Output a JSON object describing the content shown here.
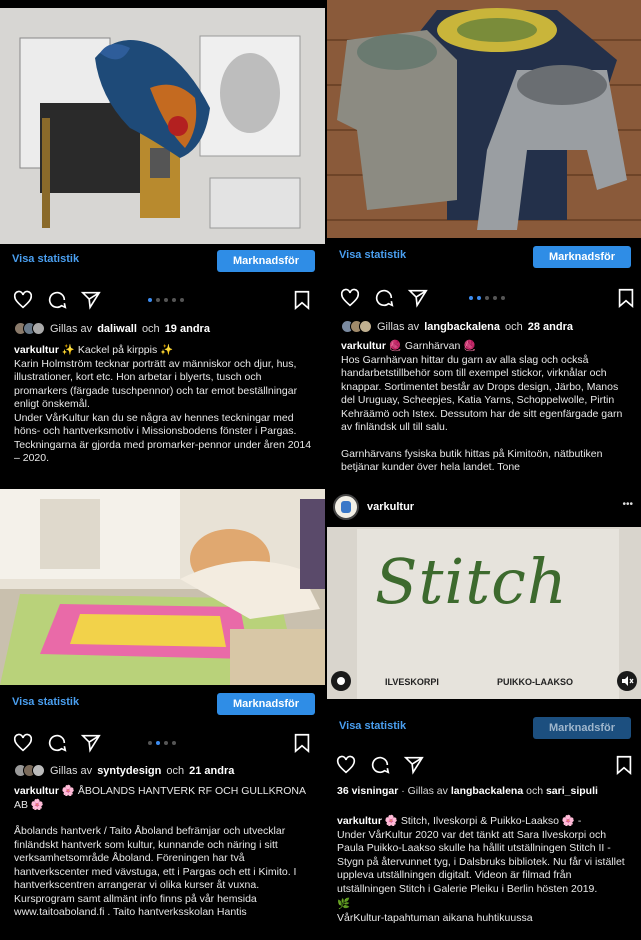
{
  "posts": [
    {
      "stats_label": "Visa statistik",
      "promote_label": "Marknadsför",
      "liked_by_prefix": "Gillas av",
      "liked_by_user": "daliwall",
      "liked_by_suffix": "och",
      "liked_by_others": "19 andra",
      "username": "varkultur",
      "caption_title": "✨ Kackel på kirppis ✨",
      "caption_body": "Karin Holmström tecknar porträtt av människor och djur, hus, illustrationer, kort etc. Hon arbetar i blyerts, tusch och promarkers (färgade tuschpennor) och tar emot beställningar enligt önskemål.",
      "caption_body2": "Under VårKultur kan du se några av hennes teckningar med höns- och hantverksmotiv i Missionsbodens fönster i Pargas. Teckningarna är gjorda med promarker-pennor under åren 2014 – 2020."
    },
    {
      "stats_label": "Visa statistik",
      "promote_label": "Marknadsför",
      "liked_by_prefix": "Gillas av",
      "liked_by_user": "langbackalena",
      "liked_by_suffix": "och",
      "liked_by_others": "28 andra",
      "username": "varkultur",
      "caption_title": "🧶 Garnhärvan 🧶",
      "caption_body": "Hos Garnhärvan hittar du garn av alla slag och också handarbetstillbehör som till exempel stickor, virknålar och knappar. Sortimentet består av Drops design, Järbo, Manos del Uruguay, Scheepjes, Katia Yarns, Schoppelwolle, Pirtin Kehräämö och Istex. Dessutom har de sitt egenfärgade garn av finländsk ull till salu.",
      "caption_body2": "Garnhärvans fysiska butik hittas på Kimitoön, nätbutiken betjänar kunder över hela landet. Tone"
    },
    {
      "stats_label": "Visa statistik",
      "promote_label": "Marknadsför",
      "liked_by_prefix": "Gillas av",
      "liked_by_user": "syntydesign",
      "liked_by_suffix": "och",
      "liked_by_others": "21 andra",
      "username": "varkultur",
      "caption_title": "🌸 ÅBOLANDS HANTVERK RF OCH GULLKRONA AB 🌸",
      "caption_body": "Åbolands hantverk / Taito Åboland befrämjar och utvecklar finländskt hantverk som kultur, kunnande och näring i sitt verksamhetsområde Åboland. Föreningen har två hantverkscenter med vävstuga, ett i Pargas och ett i Kimito. I hantverkscentren arrangerar vi olika kurser åt vuxna. Kursprogram samt allmänt info finns på vår hemsida www.taitoaboland.fi . Taito hantverksskolan Hantis"
    },
    {
      "header_username": "varkultur",
      "more_label": "•••",
      "video_title": "Stitch",
      "video_subtitle_left": "ILVESKORPI",
      "video_subtitle_right": "PUIKKO-LAAKSO",
      "stats_label": "Visa statistik",
      "promote_label": "Marknadsför",
      "views": "36 visningar",
      "liked_by_prefix": "· Gillas av",
      "liked_by_user": "langbackalena",
      "liked_by_suffix": "och",
      "liked_by_user2": "sari_sipuli",
      "username": "varkultur",
      "caption_title": "🌸 Stitch, Ilveskorpi & Puikko-Laakso 🌸 -",
      "caption_body": "Under VårKultur 2020 var det tänkt att Sara Ilveskorpi och Paula Puikko-Laakso skulle ha hållit utställningen Stitch II - Stygn på återvunnet tyg, i Dalsbruks bibliotek. Nu får vi istället uppleva utställningen digitalt. Videon är filmad från utställningen Stitch i Galerie Pleiku i Berlin hösten 2019.",
      "leaf": "🌿",
      "caption_body2": "VårKultur-tapahtuman aikana huhtikuussa"
    }
  ],
  "icons": [
    "heart-icon",
    "comment-icon",
    "share-icon",
    "bookmark-icon"
  ],
  "colors": {
    "accent": "#2f8de6",
    "link": "#4a9ff0",
    "background": "#000000"
  }
}
